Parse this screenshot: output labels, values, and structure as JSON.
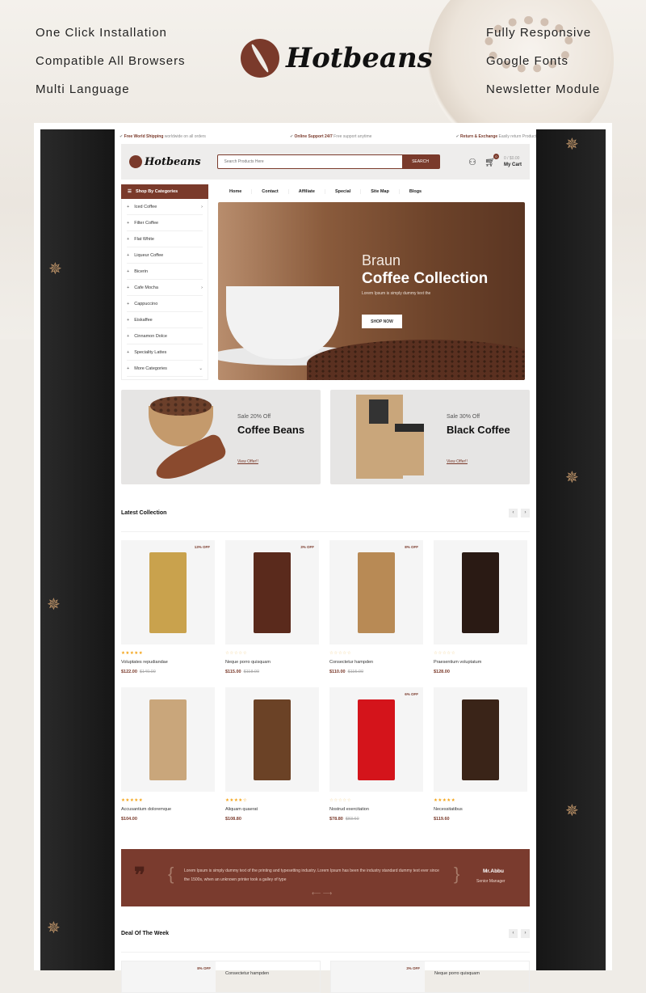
{
  "promo": {
    "features_left": [
      "One Click Installation",
      "Compatible All Browsers",
      "Multi Language"
    ],
    "features_right": [
      "Fully Responsive",
      "Google Fonts",
      "Newsletter Module"
    ],
    "brand_name": "Hotbeans"
  },
  "topbar": [
    {
      "bold": "Free World Shipping",
      "text": " worldwide on all orders"
    },
    {
      "bold": "Online Support 24/7",
      "text": " Free support anytime"
    },
    {
      "bold": "Return & Exchange",
      "text": " Easily return Product"
    }
  ],
  "header": {
    "logo": "Hotbeans",
    "search_placeholder": "Search Products Here",
    "search_button": "SEARCH",
    "cart_count": "0",
    "cart_total": "0 / $0.00",
    "cart_label": "My Cart"
  },
  "categories": {
    "title": "Shop By Categories",
    "items": [
      {
        "label": "Iced Coffee",
        "sub": true
      },
      {
        "label": "Filter Coffee",
        "sub": false
      },
      {
        "label": "Flat White",
        "sub": false
      },
      {
        "label": "Liqueur Coffee",
        "sub": false
      },
      {
        "label": "Bicerin",
        "sub": false
      },
      {
        "label": "Cafe Mocha",
        "sub": true
      },
      {
        "label": "Cappuccino",
        "sub": false
      },
      {
        "label": "Eiskaffee",
        "sub": false
      },
      {
        "label": "Cinnamon Dolce",
        "sub": false
      },
      {
        "label": "Speciality Lattes",
        "sub": false
      },
      {
        "label": "More Categories",
        "more": true
      }
    ]
  },
  "menu": [
    "Home",
    "Contact",
    "Affiliate",
    "Special",
    "Site Map",
    "Blogs"
  ],
  "hero": {
    "line1": "Braun",
    "line2": "Coffee Collection",
    "subtitle": "Lorem Ipsum is simply dummy text the",
    "button": "SHOP NOW"
  },
  "banners": [
    {
      "sale": "Sale 20% Off",
      "title": "Coffee Beans",
      "link": "View Offer!!"
    },
    {
      "sale": "Sale 30% Off",
      "title": "Black Coffee",
      "link": "View Offer!!"
    }
  ],
  "latest": {
    "title": "Latest Collection",
    "products": [
      {
        "name": "Voluptates repudiandae",
        "price": "$122.00",
        "old": "$140.00",
        "badge": "13% OFF",
        "rating": 5,
        "color": "#c9a24d"
      },
      {
        "name": "Neque porro quisquam",
        "price": "$115.00",
        "old": "$118.00",
        "badge": "3% OFF",
        "rating": 0,
        "color": "#5a2a1c"
      },
      {
        "name": "Consectetur hampden",
        "price": "$110.00",
        "old": "$115.00",
        "badge": "8% OFF",
        "rating": 0,
        "color": "#b88a55"
      },
      {
        "name": "Praesentium voluptatum",
        "price": "$128.00",
        "old": "",
        "badge": "",
        "rating": 0,
        "color": "#2a1a14"
      },
      {
        "name": "Accusantium doloremque",
        "price": "$104.00",
        "old": "",
        "badge": "",
        "rating": 5,
        "color": "#c9a67b"
      },
      {
        "name": "Aliquam quaerat",
        "price": "$108.80",
        "old": "",
        "badge": "",
        "rating": 4,
        "color": "#6b4226"
      },
      {
        "name": "Nostrud exercitation",
        "price": "$78.80",
        "old": "$83.60",
        "badge": "6% OFF",
        "rating": 0,
        "color": "#d4141b"
      },
      {
        "name": "Necessitatibus",
        "price": "$119.60",
        "old": "",
        "badge": "",
        "rating": 5,
        "color": "#3a2418"
      }
    ]
  },
  "testimonial": {
    "text": "Lorem Ipsum is simply dummy text of the printing and typesetting industry. Lorem Ipsum has been the industry standard dummy text ever since the 1500s, when an unknown printer took a galley of type",
    "name": "Mr.Abbu",
    "role": "Senior Manager",
    "nav": "⟵  ⟶"
  },
  "deal": {
    "title": "Deal Of The Week",
    "items": [
      {
        "name": "Consectetur hampden",
        "badge": "8% OFF"
      },
      {
        "name": "Neque porro quisquam",
        "badge": "3% OFF"
      }
    ]
  },
  "colors": {
    "accent": "#7a3a2b",
    "star": "#f3a316"
  }
}
